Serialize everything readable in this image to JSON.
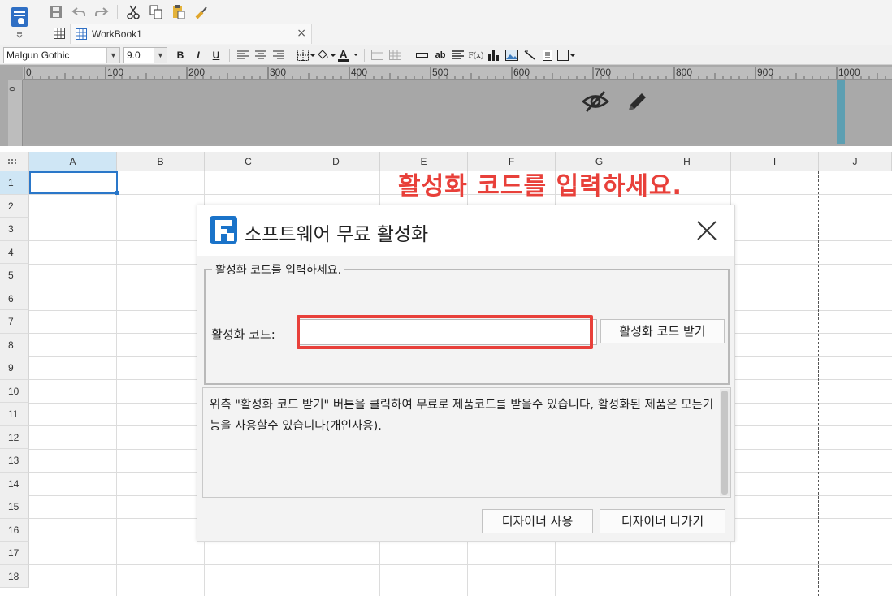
{
  "toolbar": {
    "tab_label": "WorkBook1",
    "tab_close": "×"
  },
  "formatbar": {
    "font": "Malgun Gothic",
    "font_size": "9.0",
    "bold": "B",
    "italic": "I",
    "underline": "U",
    "text_ab": "ab",
    "formula": "F(x)"
  },
  "ruler": {
    "ticks": [
      "0",
      "100",
      "200",
      "300",
      "400",
      "500",
      "600",
      "700",
      "800",
      "900",
      "1000"
    ],
    "vertical_zero": "0"
  },
  "sheet": {
    "columns": [
      "A",
      "B",
      "C",
      "D",
      "E",
      "F",
      "G",
      "H",
      "I",
      "J"
    ],
    "rows": [
      "1",
      "2",
      "3",
      "4",
      "5",
      "6",
      "7",
      "8",
      "9",
      "10",
      "11",
      "12",
      "13",
      "14",
      "15",
      "16",
      "17",
      "18"
    ],
    "selected_cell": "A1"
  },
  "annotation": {
    "text": "활성화 코드를 입력하세요.",
    "color": "#e8403a"
  },
  "dialog": {
    "title": "소프트웨어 무료 활성화",
    "group_legend": "활성화 코드를 입력하세요.",
    "code_label": "활성화 코드:",
    "code_value": "",
    "get_code_button": "활성화 코드 받기",
    "info_text": "위측 \"활성화 코드 받기\" 버튼을 클릭하여 무료로 제품코드를 받을수 있습니다, 활성화된 제품은 모든기능을 사용할수 있습니다(개인사용).",
    "use_designer_button": "디자이너 사용",
    "exit_designer_button": "디자이너 나가기",
    "logo_color": "#1a73c9"
  }
}
